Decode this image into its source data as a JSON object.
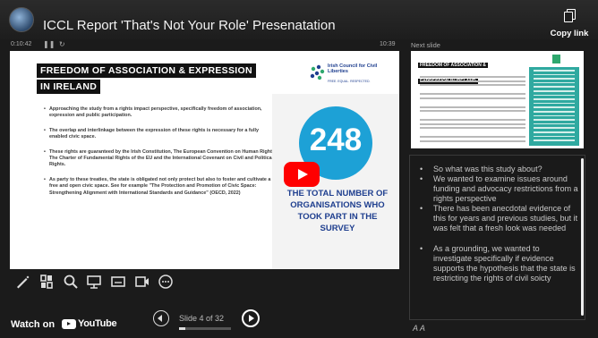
{
  "header": {
    "title": "ICCL Report 'That's Not Your Role' Presenatation",
    "copy_link_label": "Copy link"
  },
  "timing": {
    "elapsed": "0:10:42",
    "duration": "10:39",
    "next_slide_label": "Next slide"
  },
  "slide": {
    "heading": "FREEDOM OF ASSOCIATION & EXPRESSION IN IRELAND",
    "logo_text": "Irish Council for Civil Liberties",
    "logo_sub": "FREE. EQUAL. RESPECTED.",
    "bullets": [
      "Approaching the study from a rights impact perspective, specifically freedom of association, expression and public participation.",
      "The overlap and interlinkage between the expression of these rights is necessary for a fully enabled civic space.",
      "These rights are guaranteed by the Irish Constitution, The European Convention on Human Rights, The Charter of Fundamental Rights of the EU and the International Covenant on Civil and Political Rights.",
      "As party to these treaties, the state is obligated not only protect but also to foster and cultivate a free and open civic space. See for example \"The Protection and Promotion of Civic Space: Strengthening Alignment with International Standards and Guidance\" (OECD, 2022)"
    ],
    "stat_value": "248",
    "stat_caption": "THE TOTAL NUMBER OF ORGANISATIONS WHO TOOK PART IN THE SURVEY"
  },
  "next_slide": {
    "heading": "FREEDOM OF ASSOCIATION & EXPRESSION IN IRELAND"
  },
  "notes": [
    "So what was this study about?",
    "We wanted to examine issues around funding and advocacy restrictions from a rights perspective",
    "There has been anecdotal evidence of this for years and previous studies, but it was felt that a fresh look was needed",
    "As a grounding, we wanted to investigate specifically if evidence supports the hypothesis that the state is restricting the rights of civil soicty"
  ],
  "notes_font_controls": "A A",
  "footer": {
    "watch_on": "Watch on",
    "youtube": "YouTube",
    "slide_counter": "Slide 4 of 32",
    "slide_progress": 0.125
  },
  "colors": {
    "stat_circle": "#1da1d6",
    "play_button": "#ff0000",
    "thumb_green": "#2fa9a0"
  },
  "icons": [
    "pen-icon",
    "grid-icon",
    "search-icon",
    "presenter-icon",
    "subtitles-icon",
    "camera-icon",
    "more-options-icon"
  ]
}
